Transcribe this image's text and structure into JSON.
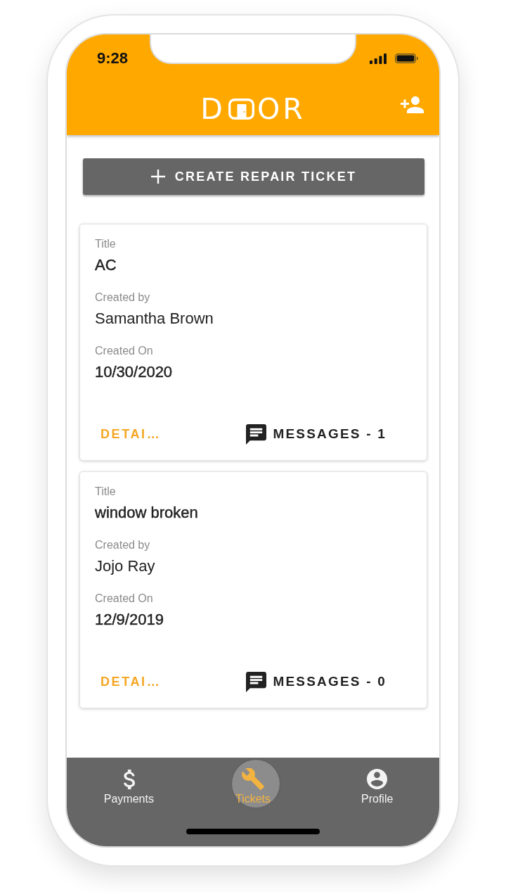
{
  "status_bar": {
    "time": "9:28"
  },
  "app_bar": {
    "logo": {
      "before": "D",
      "after": "OR"
    }
  },
  "create_button": {
    "label": "CREATE REPAIR TICKET"
  },
  "tickets": [
    {
      "fields": [
        {
          "label": "Title",
          "value": "AC"
        },
        {
          "label": "Created by",
          "value": "Samantha Brown"
        },
        {
          "label": "Created On",
          "value": "10/30/2020"
        }
      ],
      "details_button": "DETAI…",
      "messages_button": "MESSAGES - 1"
    },
    {
      "fields": [
        {
          "label": "Title",
          "value": "window broken"
        },
        {
          "label": "Created by",
          "value": "Jojo Ray"
        },
        {
          "label": "Created On",
          "value": "12/9/2019"
        }
      ],
      "details_button": "DETAI…",
      "messages_button": "MESSAGES - 0"
    }
  ],
  "bottom_nav": [
    {
      "label": "Payments",
      "selected": false
    },
    {
      "label": "Tickets",
      "selected": true
    },
    {
      "label": "Profile",
      "selected": false
    }
  ]
}
